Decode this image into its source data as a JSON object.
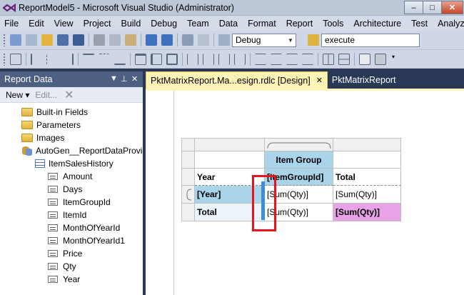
{
  "window": {
    "title": "ReportModel5 - Microsoft Visual Studio (Administrator)"
  },
  "menu": [
    "File",
    "Edit",
    "View",
    "Project",
    "Build",
    "Debug",
    "Team",
    "Data",
    "Format",
    "Report",
    "Tools",
    "Architecture",
    "Test",
    "Analyze"
  ],
  "toolbar": {
    "config": "Debug",
    "find_value": "execute"
  },
  "report_data": {
    "title": "Report Data",
    "new_label": "New ▾",
    "edit_label": "Edit...",
    "tree": [
      {
        "label": "Built-in Fields",
        "kind": "folder"
      },
      {
        "label": "Parameters",
        "kind": "folder"
      },
      {
        "label": "Images",
        "kind": "folder"
      },
      {
        "label": "AutoGen__ReportDataProvider",
        "kind": "datasource"
      },
      {
        "label": "ItemSalesHistory",
        "kind": "dataset"
      },
      {
        "label": "Amount",
        "kind": "field"
      },
      {
        "label": "Days",
        "kind": "field"
      },
      {
        "label": "ItemGroupId",
        "kind": "field"
      },
      {
        "label": "ItemId",
        "kind": "field"
      },
      {
        "label": "MonthOfYearId",
        "kind": "field"
      },
      {
        "label": "MonthOfYearId1",
        "kind": "field"
      },
      {
        "label": "Price",
        "kind": "field"
      },
      {
        "label": "Qty",
        "kind": "field"
      },
      {
        "label": "Year",
        "kind": "field"
      }
    ]
  },
  "tabs": [
    {
      "label": "PktMatrixReport.Ma...esign.rdlc [Design]",
      "active": true
    },
    {
      "label": "PktMatrixReport",
      "active": false
    }
  ],
  "matrix": {
    "col_group_header": "Item Group",
    "col_group_field": "[ItemGroupId]",
    "row_header": "Year",
    "total_header": "Total",
    "row_field": "[Year]",
    "data_cell": "[Sum(Qty)]",
    "total_cell": "[Sum(Qty)]",
    "row_total_label": "Total",
    "row_total_cell": "[Sum(Qty)]",
    "grand_total_cell": "[Sum(Qty)]"
  },
  "colors": {
    "accent_tab": "#fff3b8",
    "highlight_red": "#e8141b",
    "group_header_blue": "#a9d4ea",
    "grand_total_pink": "#e8a3e8"
  }
}
